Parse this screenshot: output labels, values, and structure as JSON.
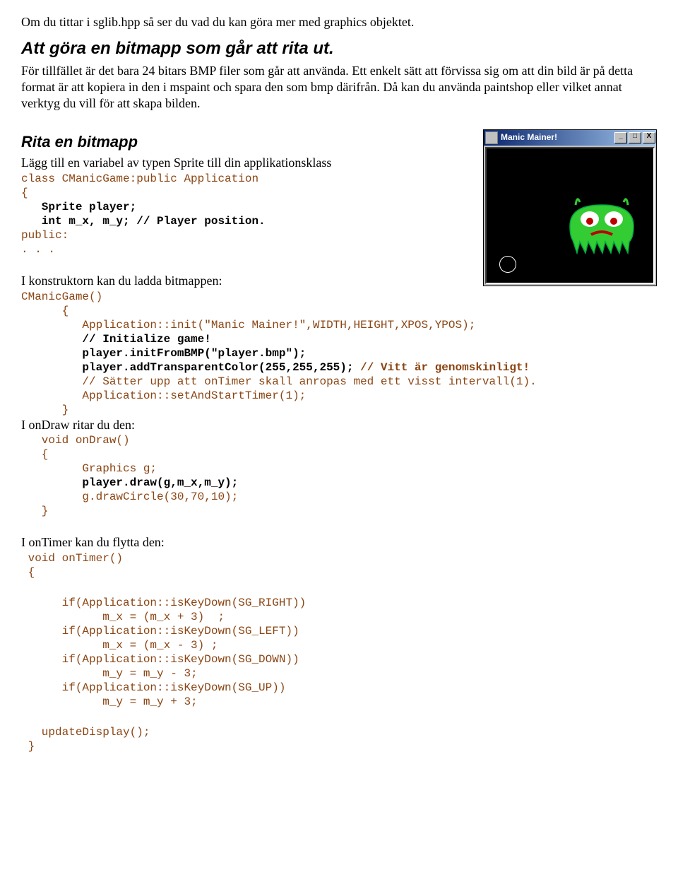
{
  "intro": {
    "p1": "Om du tittar i sglib.hpp så ser du vad du kan göra mer med graphics objektet.",
    "h2": "Att göra en bitmapp som går att rita ut.",
    "p2": "För tillfället är det bara 24 bitars BMP filer som går att använda. Ett enkelt sätt att förvissa sig om att din bild är på detta format är att kopiera in den i mspaint och spara den som bmp därifrån. Då kan du använda paintshop eller vilket annat verktyg du vill för att skapa bilden."
  },
  "window": {
    "title": "Manic Mainer!",
    "min": "_",
    "max": "□",
    "close": "X"
  },
  "sec1": {
    "h3": "Rita en bitmapp",
    "intro": "Lägg till en variabel av typen Sprite till din applikationsklass",
    "code_class": "class CManicGame:public Application",
    "code_brace_open": "{",
    "code_sprite": "   Sprite player;",
    "code_pos": "   int m_x, m_y; // Player position.",
    "code_public": "public:",
    "code_dots": ". . ."
  },
  "sec2": {
    "intro": "I konstruktorn kan du ladda bitmappen:",
    "l1": "CManicGame()",
    "l2": "      {",
    "l3": "         Application::init(\"Manic Mainer!\",WIDTH,HEIGHT,XPOS,YPOS);",
    "l4": "         // Initialize game!",
    "l5": "         player.initFromBMP(\"player.bmp\");",
    "l6a": "         player.addTransparentColor(255,255,255);",
    "l6b": " // Vitt är genomskinligt!",
    "l7": "         // Sätter upp att onTimer skall anropas med ett visst intervall(1).",
    "l8": "         Application::setAndStartTimer(1);",
    "l9": "      }"
  },
  "sec3": {
    "intro": "I onDraw ritar du den:",
    "l1": "   void onDraw()",
    "l2": "   {",
    "l3": "         Graphics g;",
    "l4": "         player.draw(g,m_x,m_y);",
    "l5": "         g.drawCircle(30,70,10);",
    "l6": "   }"
  },
  "sec4": {
    "intro": "I onTimer kan du flytta den:",
    "l1": " void onTimer()",
    "l2": " {",
    "b1": "      if(Application::isKeyDown(SG_RIGHT))",
    "b2": "            m_x = (m_x + 3)  ;",
    "b3": "      if(Application::isKeyDown(SG_LEFT))",
    "b4": "            m_x = (m_x - 3) ;",
    "b5": "      if(Application::isKeyDown(SG_DOWN))",
    "b6": "            m_y = m_y - 3;",
    "b7": "      if(Application::isKeyDown(SG_UP))",
    "b8": "            m_y = m_y + 3;",
    "u1": "   updateDisplay();",
    "u2": " }"
  }
}
